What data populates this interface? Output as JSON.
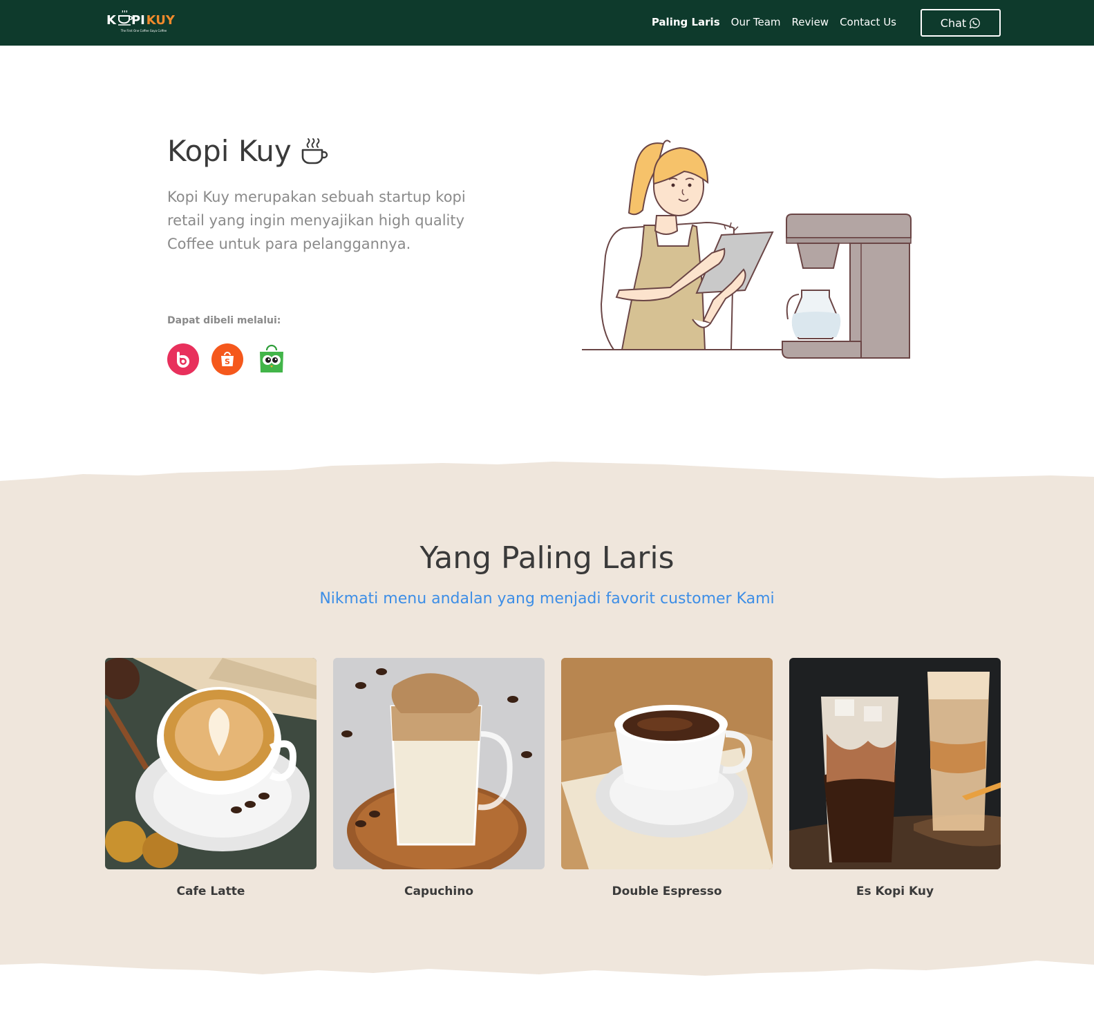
{
  "header": {
    "logo": {
      "k": "K",
      "pi": "PI",
      "kuy": "KUY",
      "tagline": "The First One Coffee Gaya Coffee"
    },
    "nav": [
      {
        "label": "Paling Laris",
        "active": true
      },
      {
        "label": "Our Team",
        "active": false
      },
      {
        "label": "Review",
        "active": false
      },
      {
        "label": "Contact Us",
        "active": false
      }
    ],
    "chat_label": "Chat",
    "chat_icon": "whatsapp-icon"
  },
  "hero": {
    "title": "Kopi Kuy",
    "title_icon": "hot-coffee-cup-icon",
    "description": "Kopi Kuy merupakan sebuah startup kopi retail yang ingin menyajikan high quality Coffee untuk para pelanggannya.",
    "buy_label": "Dapat dibeli melalui:",
    "stores": [
      {
        "name": "blibli",
        "icon": "blibli-icon",
        "color": "#e8305c"
      },
      {
        "name": "shopee",
        "icon": "shopee-icon",
        "color": "#f5581c"
      },
      {
        "name": "tokopedia",
        "icon": "tokopedia-icon",
        "color": "#42b549"
      }
    ]
  },
  "best_seller": {
    "title": "Yang Paling Laris",
    "subtitle": "Nikmati menu andalan yang menjadi favorit customer Kami",
    "products": [
      {
        "name": "Cafe Latte"
      },
      {
        "name": "Capuchino"
      },
      {
        "name": "Double Espresso"
      },
      {
        "name": "Es Kopi Kuy"
      }
    ]
  },
  "colors": {
    "nav_bg": "#0e3a2c",
    "accent_orange": "#f08a2c",
    "section_bg": "#efe6dc",
    "subtitle_blue": "#3d8ee6"
  }
}
